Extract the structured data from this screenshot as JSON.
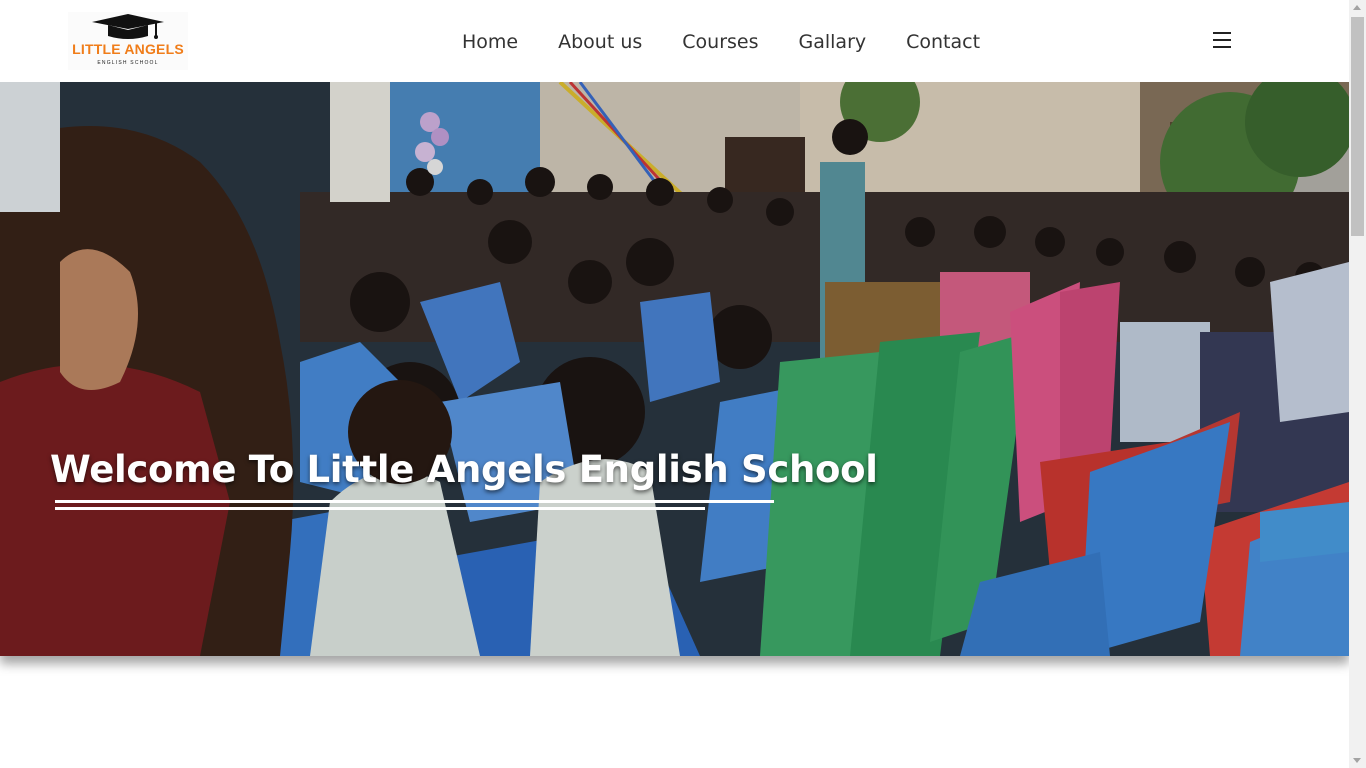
{
  "header": {
    "logo": {
      "title": "LITTLE ANGELS",
      "subtitle": "ENGLISH SCHOOL",
      "icon": "graduation-cap-icon"
    },
    "nav": [
      {
        "label": "Home"
      },
      {
        "label": "About us"
      },
      {
        "label": "Courses"
      },
      {
        "label": "Gallary"
      },
      {
        "label": "Contact"
      }
    ],
    "menu_icon": "hamburger-menu-icon"
  },
  "hero": {
    "title": "Welcome To Little Angels English School",
    "image": "school event with children seated on plastic chairs"
  },
  "colors": {
    "brand_orange": "#f07d1a",
    "nav_text": "#333333",
    "hero_text": "#ffffff"
  }
}
